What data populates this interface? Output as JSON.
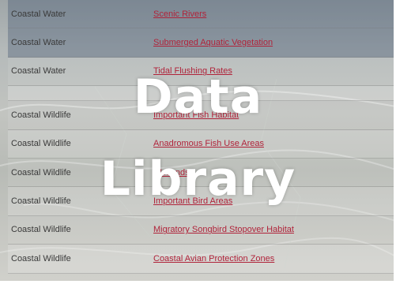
{
  "overlay": {
    "line1": "Data",
    "line2": "Library"
  },
  "rows": [
    {
      "category": "Coastal Water",
      "link": "Scenic Rivers"
    },
    {
      "category": "Coastal Water",
      "link": "Submerged Aquatic Vegetation"
    },
    {
      "category": "Coastal Water",
      "link": "Tidal Flushing Rates"
    },
    {
      "category": "",
      "link": ""
    },
    {
      "category": "Coastal Wildlife",
      "link": "Important Fish Habitat"
    },
    {
      "category": "Coastal Wildlife",
      "link": "Anadromous Fish Use Areas"
    },
    {
      "category": "Coastal Wildlife",
      "link": "Wetlands"
    },
    {
      "category": "Coastal Wildlife",
      "link": "Important Bird Areas"
    },
    {
      "category": "Coastal Wildlife",
      "link": "Migratory Songbird Stopover Habitat"
    },
    {
      "category": "Coastal Wildlife",
      "link": "Coastal Avian Protection Zones"
    }
  ],
  "colors": {
    "link": "#b0233a",
    "category_text": "#3a3a3a",
    "overlay_text": "#ffffff"
  }
}
